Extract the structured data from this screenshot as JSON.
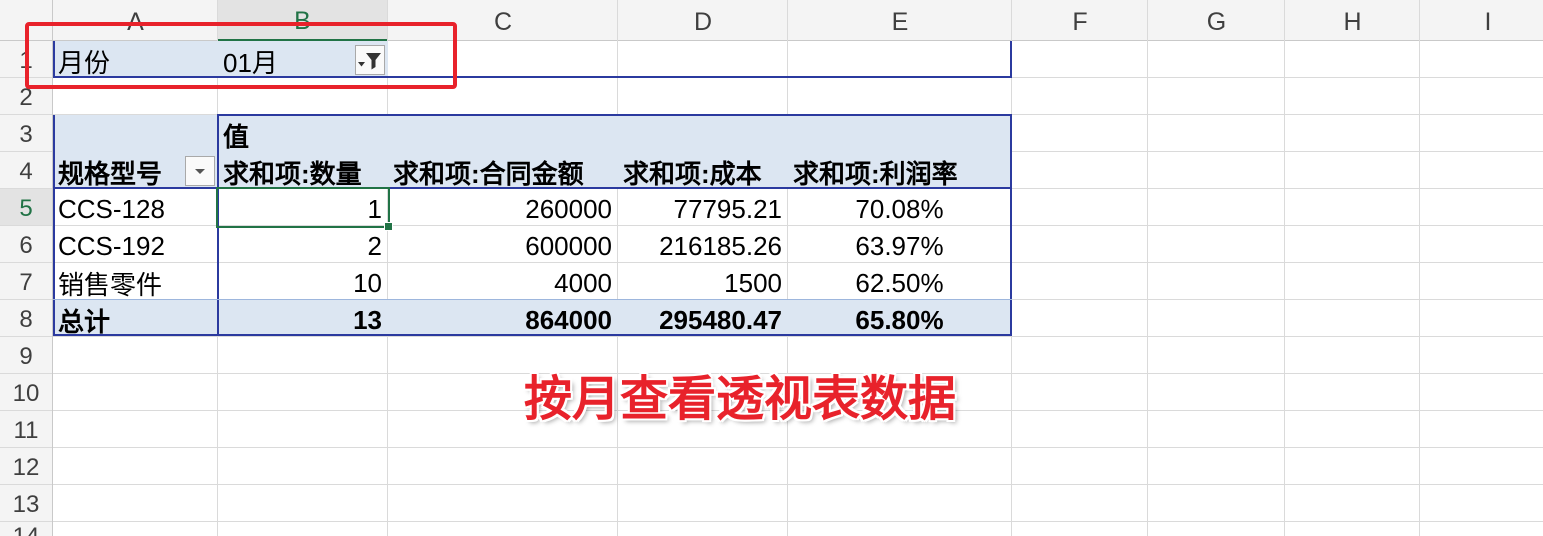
{
  "column_headers": [
    "A",
    "B",
    "C",
    "D",
    "E",
    "F",
    "G",
    "H",
    "I"
  ],
  "row_headers": [
    "1",
    "2",
    "3",
    "4",
    "5",
    "6",
    "7",
    "8",
    "9",
    "10",
    "11",
    "12",
    "13",
    "14"
  ],
  "pivot": {
    "filter_field": {
      "label": "月份",
      "value": "01月"
    },
    "values_caption": "值",
    "row_field_label": "规格型号",
    "value_headers": [
      "求和项:数量",
      "求和项:合同金额",
      "求和项:成本",
      "求和项:利润率"
    ],
    "rows": [
      {
        "item": "CCS-128",
        "values": [
          "1",
          "260000",
          "77795.21",
          "70.08%"
        ]
      },
      {
        "item": "CCS-192",
        "values": [
          "2",
          "600000",
          "216185.26",
          "63.97%"
        ]
      },
      {
        "item": "销售零件",
        "values": [
          "10",
          "4000",
          "1500",
          "62.50%"
        ]
      }
    ],
    "grand_total": {
      "label": "总计",
      "values": [
        "13",
        "864000",
        "295480.47",
        "65.80%"
      ]
    }
  },
  "annotation": {
    "text": "按月查看透视表数据"
  },
  "icons": {
    "month_filter_button": "filter-funnel-icon",
    "row_field_button": "chevron-down-icon"
  },
  "colors": {
    "selection_green": "#217346",
    "pivot_fill": "#dce6f2",
    "pivot_border": "#2b3a9f",
    "pivot_total_separator": "#9db6dd",
    "annotation_red": "#e8222b"
  }
}
